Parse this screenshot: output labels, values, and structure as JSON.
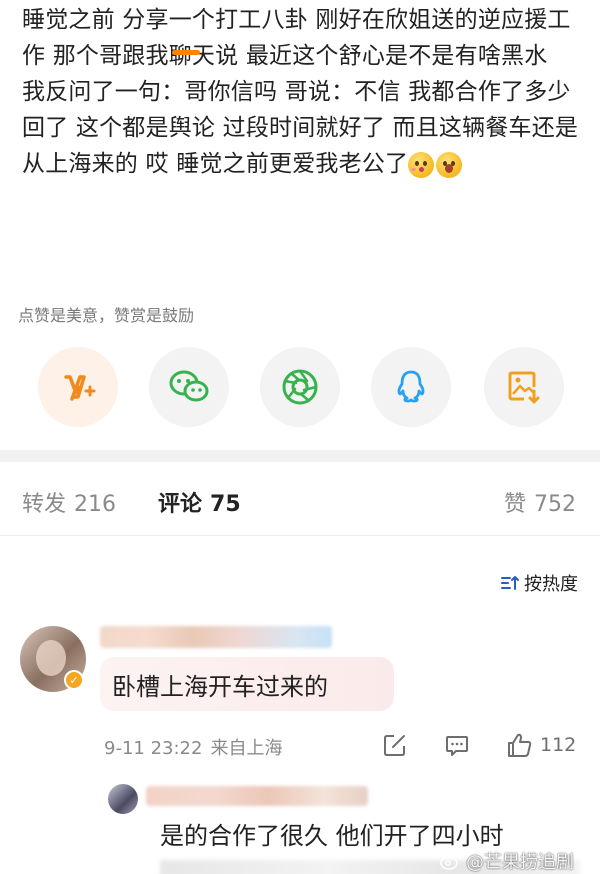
{
  "post": {
    "text_line1": "睡觉之前 分享一个打工八卦 刚好在欣姐送的逆应援工作 那个哥跟我聊天说 最近这个舒心是不是有啥黑水",
    "text_line2": "我反问了一句：哥你信吗 哥说：不信 我都合作了多少回了 这个都是舆论 过段时间就好了 而且这辆餐车还是从上海来的 哎 睡觉之前更爱我老公了",
    "emojis": [
      "kiss-face-emoji",
      "surprised-face-emoji"
    ]
  },
  "tip": "点赞是美意，赞赏是鼓励",
  "share_buttons": [
    {
      "name": "weibo-v-plus",
      "icon": "v-plus-icon",
      "color": "#f08a1c"
    },
    {
      "name": "wechat",
      "icon": "wechat-icon",
      "color": "#37b24d"
    },
    {
      "name": "moments",
      "icon": "shutter-icon",
      "color": "#37b24d"
    },
    {
      "name": "qq",
      "icon": "qq-penguin-icon",
      "color": "#2aa1f0"
    },
    {
      "name": "save-image",
      "icon": "image-download-icon",
      "color": "#f0a020"
    }
  ],
  "tabs": {
    "repost": {
      "label": "转发",
      "count": "216"
    },
    "comments": {
      "label": "评论",
      "count": "75"
    },
    "likes": {
      "label": "赞",
      "count": "752"
    }
  },
  "sort_label": "按热度",
  "comment": {
    "text": "卧槽上海开车过来的",
    "time": "9-11 23:22",
    "location": "来自上海",
    "like_count": "112"
  },
  "reply": {
    "text": "是的合作了很久 他们开了四小时"
  },
  "watermark": "@芒果捞追剧",
  "accent_color": "#ff8200"
}
